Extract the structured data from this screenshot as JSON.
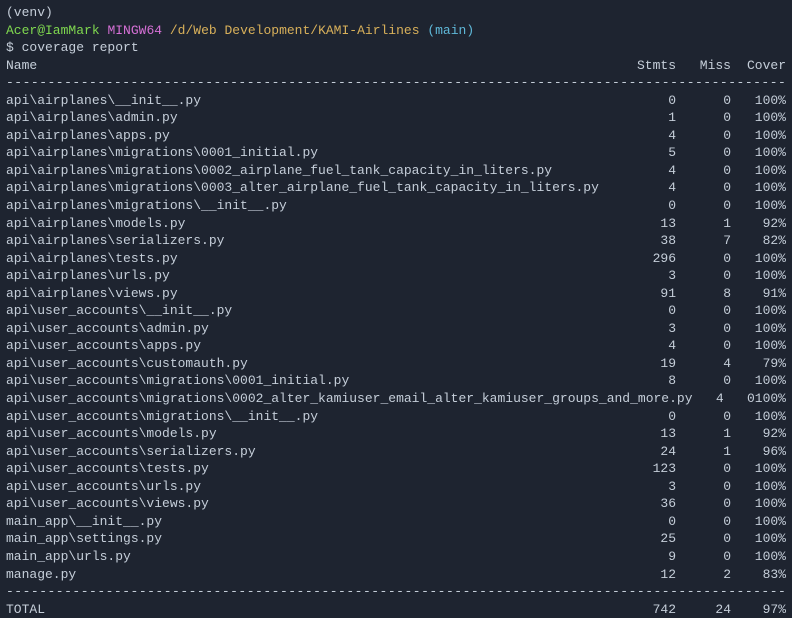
{
  "prompt": {
    "venv": "(venv)",
    "user": "Acer@IamMark",
    "shell": "MINGW64",
    "path": "/d/Web Development/KAMI-Airlines",
    "branch": "(main)",
    "command_prefix": "$ ",
    "command": "coverage report"
  },
  "header": {
    "name": "Name",
    "stmts": "Stmts",
    "miss": "Miss",
    "cover": "Cover"
  },
  "divider": "------------------------------------------------------------------------------------------------------------",
  "rows": [
    {
      "name": "api\\airplanes\\__init__.py",
      "stmts": "0",
      "miss": "0",
      "cover": "100%"
    },
    {
      "name": "api\\airplanes\\admin.py",
      "stmts": "1",
      "miss": "0",
      "cover": "100%"
    },
    {
      "name": "api\\airplanes\\apps.py",
      "stmts": "4",
      "miss": "0",
      "cover": "100%"
    },
    {
      "name": "api\\airplanes\\migrations\\0001_initial.py",
      "stmts": "5",
      "miss": "0",
      "cover": "100%"
    },
    {
      "name": "api\\airplanes\\migrations\\0002_airplane_fuel_tank_capacity_in_liters.py",
      "stmts": "4",
      "miss": "0",
      "cover": "100%"
    },
    {
      "name": "api\\airplanes\\migrations\\0003_alter_airplane_fuel_tank_capacity_in_liters.py",
      "stmts": "4",
      "miss": "0",
      "cover": "100%"
    },
    {
      "name": "api\\airplanes\\migrations\\__init__.py",
      "stmts": "0",
      "miss": "0",
      "cover": "100%"
    },
    {
      "name": "api\\airplanes\\models.py",
      "stmts": "13",
      "miss": "1",
      "cover": "92%"
    },
    {
      "name": "api\\airplanes\\serializers.py",
      "stmts": "38",
      "miss": "7",
      "cover": "82%"
    },
    {
      "name": "api\\airplanes\\tests.py",
      "stmts": "296",
      "miss": "0",
      "cover": "100%"
    },
    {
      "name": "api\\airplanes\\urls.py",
      "stmts": "3",
      "miss": "0",
      "cover": "100%"
    },
    {
      "name": "api\\airplanes\\views.py",
      "stmts": "91",
      "miss": "8",
      "cover": "91%"
    },
    {
      "name": "api\\user_accounts\\__init__.py",
      "stmts": "0",
      "miss": "0",
      "cover": "100%"
    },
    {
      "name": "api\\user_accounts\\admin.py",
      "stmts": "3",
      "miss": "0",
      "cover": "100%"
    },
    {
      "name": "api\\user_accounts\\apps.py",
      "stmts": "4",
      "miss": "0",
      "cover": "100%"
    },
    {
      "name": "api\\user_accounts\\customauth.py",
      "stmts": "19",
      "miss": "4",
      "cover": "79%"
    },
    {
      "name": "api\\user_accounts\\migrations\\0001_initial.py",
      "stmts": "8",
      "miss": "0",
      "cover": "100%"
    },
    {
      "name": "api\\user_accounts\\migrations\\0002_alter_kamiuser_email_alter_kamiuser_groups_and_more.py",
      "stmts": "4",
      "miss": "0",
      "cover": "100%"
    },
    {
      "name": "api\\user_accounts\\migrations\\__init__.py",
      "stmts": "0",
      "miss": "0",
      "cover": "100%"
    },
    {
      "name": "api\\user_accounts\\models.py",
      "stmts": "13",
      "miss": "1",
      "cover": "92%"
    },
    {
      "name": "api\\user_accounts\\serializers.py",
      "stmts": "24",
      "miss": "1",
      "cover": "96%"
    },
    {
      "name": "api\\user_accounts\\tests.py",
      "stmts": "123",
      "miss": "0",
      "cover": "100%"
    },
    {
      "name": "api\\user_accounts\\urls.py",
      "stmts": "3",
      "miss": "0",
      "cover": "100%"
    },
    {
      "name": "api\\user_accounts\\views.py",
      "stmts": "36",
      "miss": "0",
      "cover": "100%"
    },
    {
      "name": "main_app\\__init__.py",
      "stmts": "0",
      "miss": "0",
      "cover": "100%"
    },
    {
      "name": "main_app\\settings.py",
      "stmts": "25",
      "miss": "0",
      "cover": "100%"
    },
    {
      "name": "main_app\\urls.py",
      "stmts": "9",
      "miss": "0",
      "cover": "100%"
    },
    {
      "name": "manage.py",
      "stmts": "12",
      "miss": "2",
      "cover": "83%"
    }
  ],
  "total": {
    "label": "TOTAL",
    "stmts": "742",
    "miss": "24",
    "cover": "97%"
  }
}
